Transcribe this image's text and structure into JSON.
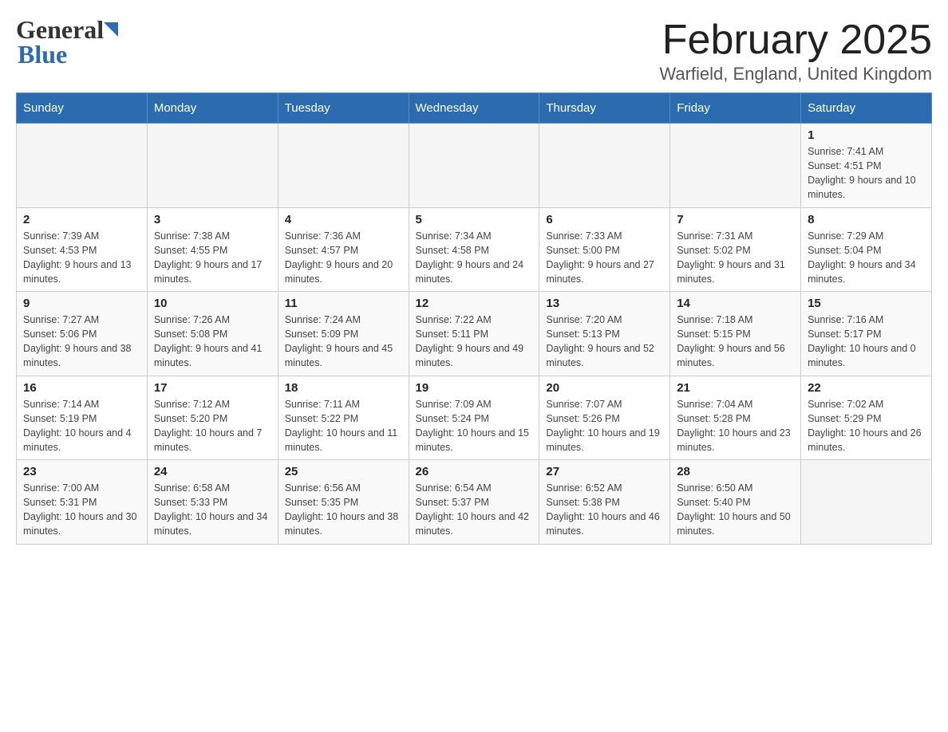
{
  "header": {
    "logo_general": "General",
    "logo_blue": "Blue",
    "title": "February 2025",
    "subtitle": "Warfield, England, United Kingdom"
  },
  "days_of_week": [
    "Sunday",
    "Monday",
    "Tuesday",
    "Wednesday",
    "Thursday",
    "Friday",
    "Saturday"
  ],
  "weeks": [
    {
      "days": [
        {
          "number": "",
          "info": ""
        },
        {
          "number": "",
          "info": ""
        },
        {
          "number": "",
          "info": ""
        },
        {
          "number": "",
          "info": ""
        },
        {
          "number": "",
          "info": ""
        },
        {
          "number": "",
          "info": ""
        },
        {
          "number": "1",
          "info": "Sunrise: 7:41 AM\nSunset: 4:51 PM\nDaylight: 9 hours and 10 minutes."
        }
      ]
    },
    {
      "days": [
        {
          "number": "2",
          "info": "Sunrise: 7:39 AM\nSunset: 4:53 PM\nDaylight: 9 hours and 13 minutes."
        },
        {
          "number": "3",
          "info": "Sunrise: 7:38 AM\nSunset: 4:55 PM\nDaylight: 9 hours and 17 minutes."
        },
        {
          "number": "4",
          "info": "Sunrise: 7:36 AM\nSunset: 4:57 PM\nDaylight: 9 hours and 20 minutes."
        },
        {
          "number": "5",
          "info": "Sunrise: 7:34 AM\nSunset: 4:58 PM\nDaylight: 9 hours and 24 minutes."
        },
        {
          "number": "6",
          "info": "Sunrise: 7:33 AM\nSunset: 5:00 PM\nDaylight: 9 hours and 27 minutes."
        },
        {
          "number": "7",
          "info": "Sunrise: 7:31 AM\nSunset: 5:02 PM\nDaylight: 9 hours and 31 minutes."
        },
        {
          "number": "8",
          "info": "Sunrise: 7:29 AM\nSunset: 5:04 PM\nDaylight: 9 hours and 34 minutes."
        }
      ]
    },
    {
      "days": [
        {
          "number": "9",
          "info": "Sunrise: 7:27 AM\nSunset: 5:06 PM\nDaylight: 9 hours and 38 minutes."
        },
        {
          "number": "10",
          "info": "Sunrise: 7:26 AM\nSunset: 5:08 PM\nDaylight: 9 hours and 41 minutes."
        },
        {
          "number": "11",
          "info": "Sunrise: 7:24 AM\nSunset: 5:09 PM\nDaylight: 9 hours and 45 minutes."
        },
        {
          "number": "12",
          "info": "Sunrise: 7:22 AM\nSunset: 5:11 PM\nDaylight: 9 hours and 49 minutes."
        },
        {
          "number": "13",
          "info": "Sunrise: 7:20 AM\nSunset: 5:13 PM\nDaylight: 9 hours and 52 minutes."
        },
        {
          "number": "14",
          "info": "Sunrise: 7:18 AM\nSunset: 5:15 PM\nDaylight: 9 hours and 56 minutes."
        },
        {
          "number": "15",
          "info": "Sunrise: 7:16 AM\nSunset: 5:17 PM\nDaylight: 10 hours and 0 minutes."
        }
      ]
    },
    {
      "days": [
        {
          "number": "16",
          "info": "Sunrise: 7:14 AM\nSunset: 5:19 PM\nDaylight: 10 hours and 4 minutes."
        },
        {
          "number": "17",
          "info": "Sunrise: 7:12 AM\nSunset: 5:20 PM\nDaylight: 10 hours and 7 minutes."
        },
        {
          "number": "18",
          "info": "Sunrise: 7:11 AM\nSunset: 5:22 PM\nDaylight: 10 hours and 11 minutes."
        },
        {
          "number": "19",
          "info": "Sunrise: 7:09 AM\nSunset: 5:24 PM\nDaylight: 10 hours and 15 minutes."
        },
        {
          "number": "20",
          "info": "Sunrise: 7:07 AM\nSunset: 5:26 PM\nDaylight: 10 hours and 19 minutes."
        },
        {
          "number": "21",
          "info": "Sunrise: 7:04 AM\nSunset: 5:28 PM\nDaylight: 10 hours and 23 minutes."
        },
        {
          "number": "22",
          "info": "Sunrise: 7:02 AM\nSunset: 5:29 PM\nDaylight: 10 hours and 26 minutes."
        }
      ]
    },
    {
      "days": [
        {
          "number": "23",
          "info": "Sunrise: 7:00 AM\nSunset: 5:31 PM\nDaylight: 10 hours and 30 minutes."
        },
        {
          "number": "24",
          "info": "Sunrise: 6:58 AM\nSunset: 5:33 PM\nDaylight: 10 hours and 34 minutes."
        },
        {
          "number": "25",
          "info": "Sunrise: 6:56 AM\nSunset: 5:35 PM\nDaylight: 10 hours and 38 minutes."
        },
        {
          "number": "26",
          "info": "Sunrise: 6:54 AM\nSunset: 5:37 PM\nDaylight: 10 hours and 42 minutes."
        },
        {
          "number": "27",
          "info": "Sunrise: 6:52 AM\nSunset: 5:38 PM\nDaylight: 10 hours and 46 minutes."
        },
        {
          "number": "28",
          "info": "Sunrise: 6:50 AM\nSunset: 5:40 PM\nDaylight: 10 hours and 50 minutes."
        },
        {
          "number": "",
          "info": ""
        }
      ]
    }
  ]
}
